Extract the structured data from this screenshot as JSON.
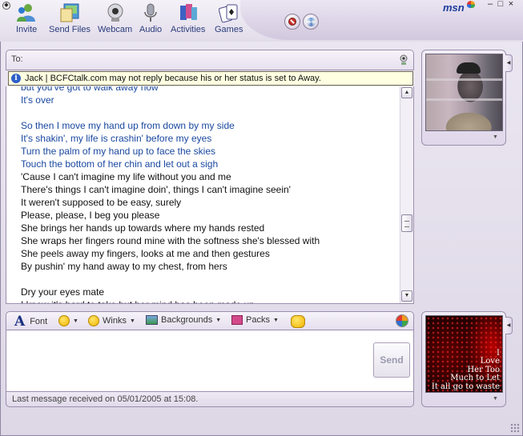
{
  "window": {
    "brand": "msn",
    "controls": [
      "–",
      "□",
      "×"
    ]
  },
  "toolbar": {
    "items": [
      {
        "label": "Invite",
        "icon": "invite-icon"
      },
      {
        "label": "Send Files",
        "icon": "send-files-icon"
      },
      {
        "label": "Webcam",
        "icon": "webcam-icon"
      },
      {
        "label": "Audio",
        "icon": "audio-icon"
      },
      {
        "label": "Activities",
        "icon": "activities-icon"
      },
      {
        "label": "Games",
        "icon": "games-icon"
      }
    ],
    "right_buttons": [
      "block-icon",
      "background-icon"
    ]
  },
  "to_bar": {
    "label": "To:"
  },
  "info_bar": {
    "text": "Jack | BCFCtalk.com may not reply because his or her status is set to Away."
  },
  "conversation": {
    "lines": [
      {
        "text": "but you've got to walk away now",
        "color": "blue"
      },
      {
        "text": "It's over",
        "color": "blue"
      },
      {
        "text": "",
        "color": "blue"
      },
      {
        "text": "So then I move my hand up from down by my side",
        "color": "blue"
      },
      {
        "text": "It's shakin', my life is crashin' before my eyes",
        "color": "blue"
      },
      {
        "text": "Turn the palm of my hand up to face the skies",
        "color": "blue"
      },
      {
        "text": "Touch the bottom of her chin and let out a sigh",
        "color": "blue"
      },
      {
        "text": "'Cause I can't imagine my life without you and me",
        "color": "dark"
      },
      {
        "text": "There's things I can't imagine doin', things I can't imagine seein'",
        "color": "dark"
      },
      {
        "text": "It weren't supposed to be easy, surely",
        "color": "dark"
      },
      {
        "text": "Please, please, I beg you please",
        "color": "dark"
      },
      {
        "text": "She brings her hands up towards where my hands rested",
        "color": "dark"
      },
      {
        "text": "She wraps her fingers round mine with the softness she's blessed with",
        "color": "dark"
      },
      {
        "text": "She peels away my fingers, looks at me and then gestures",
        "color": "dark"
      },
      {
        "text": "By pushin' my hand away to my chest, from hers",
        "color": "dark"
      },
      {
        "text": "",
        "color": "dark"
      },
      {
        "text": "Dry your eyes mate",
        "color": "dark"
      },
      {
        "text": "I know it's hard to take but her mind has been made up",
        "color": "dark"
      }
    ]
  },
  "format_bar": {
    "font": "Font",
    "winks": "Winks",
    "backgrounds": "Backgrounds",
    "packs": "Packs"
  },
  "input": {
    "send": "Send"
  },
  "status": {
    "text": "Last message received on 05/01/2005 at 15:08."
  },
  "display_picture": {
    "caption_lines": [
      "I",
      "Love",
      "Her Too",
      "Much to Let",
      "It all go to waste"
    ]
  },
  "colors": {
    "accent": "#1a48a0",
    "frame": "#9b8fae",
    "info_background": "#ffffe1"
  }
}
